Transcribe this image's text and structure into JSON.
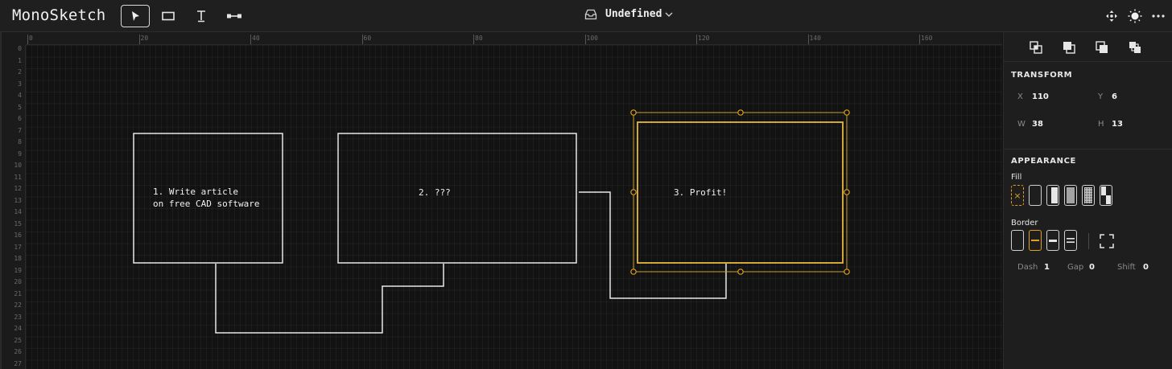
{
  "app": {
    "title": "MonoSketch"
  },
  "toolbar": {
    "tools": [
      {
        "name": "select",
        "icon": "pointer-icon",
        "active": true
      },
      {
        "name": "rectangle",
        "icon": "rectangle-icon",
        "active": false
      },
      {
        "name": "text",
        "icon": "text-icon",
        "active": false
      },
      {
        "name": "line",
        "icon": "line-icon",
        "active": false
      }
    ],
    "document": {
      "name": "Undefined",
      "icon": "inbox-icon",
      "dropdown_icon": "chevron-down-icon"
    },
    "right_icons": [
      "move-icon",
      "theme-sun-icon",
      "more-icon"
    ]
  },
  "ruler": {
    "top_labels": [
      "0",
      "20",
      "40",
      "60",
      "80",
      "100",
      "120",
      "140",
      "160"
    ],
    "left_labels": [
      "0",
      "1",
      "2",
      "3",
      "4",
      "5",
      "6",
      "7",
      "8",
      "9",
      "10",
      "11",
      "12",
      "13",
      "14",
      "15",
      "16",
      "17",
      "18",
      "19",
      "20",
      "21",
      "22",
      "23",
      "24",
      "25",
      "26",
      "27"
    ]
  },
  "canvas": {
    "shapes": [
      {
        "id": "box1",
        "text": "1. Write article\non free CAD software"
      },
      {
        "id": "box2",
        "text": "2. ???"
      },
      {
        "id": "box3",
        "text": "3. Profit!"
      }
    ]
  },
  "panel": {
    "arrange_icons": [
      "bring-to-front-icon",
      "bring-forward-icon",
      "send-backward-icon",
      "send-to-back-icon"
    ],
    "transform": {
      "title": "TRANSFORM",
      "x_label": "X",
      "x": "110",
      "y_label": "Y",
      "y": "6",
      "w_label": "W",
      "w": "38",
      "h_label": "H",
      "h": "13"
    },
    "appearance": {
      "title": "APPEARANCE",
      "fill_label": "Fill",
      "border_label": "Border",
      "dash_label": "Dash",
      "dash": "1",
      "gap_label": "Gap",
      "gap": "0",
      "shift_label": "Shift",
      "shift": "0"
    },
    "colors": {
      "accent": "#e0a020",
      "selection": "#e8b83a"
    }
  }
}
